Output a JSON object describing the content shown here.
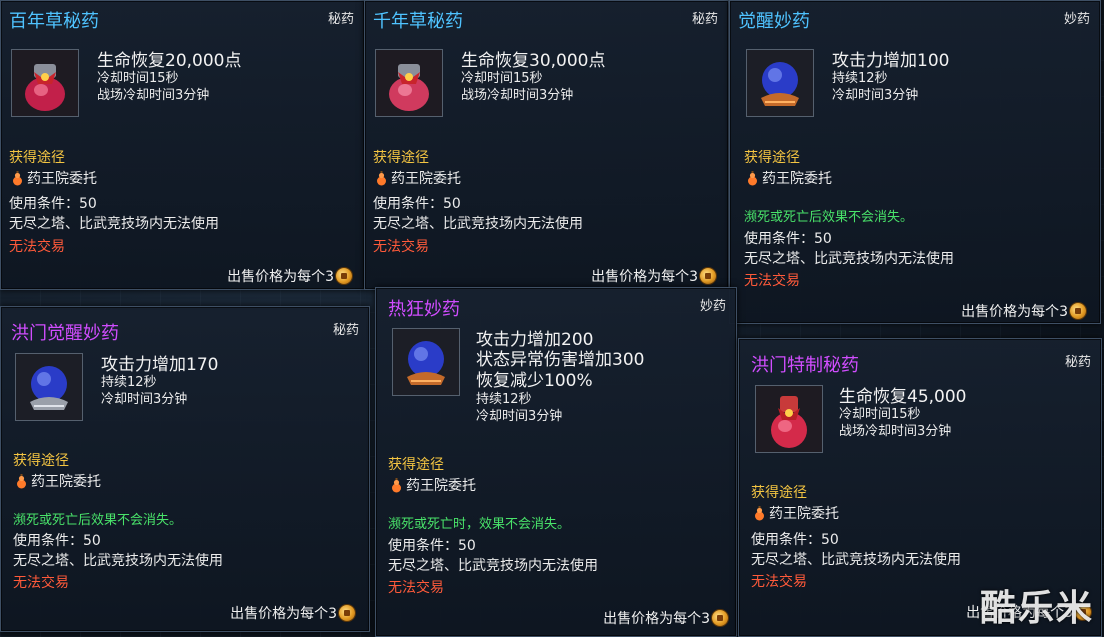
{
  "sell_label": "出售价格为每个3",
  "source_heading": "获得途径",
  "source_item": "药王院委托",
  "persist_green_a": "濒死或死亡后效果不会消失。",
  "persist_green_b": "濒死或死亡时，效果不会消失。",
  "use_condition": "使用条件：50",
  "restriction": "无尽之塔、比武竞技场内无法使用",
  "no_trade": "无法交易",
  "watermark": "酷乐米",
  "colors": {
    "title_blue": "#4fc3ff",
    "title_purple": "#d14dff",
    "source_heading": "#f4c542",
    "green_note": "#49e36a",
    "no_trade": "#ff5a3a"
  },
  "cards": [
    {
      "title": "百年草秘药",
      "category": "秘药",
      "icon": "red-potion-icon",
      "effects": [
        "生命恢复20,000点"
      ],
      "details": [
        "冷却时间15秒",
        "战场冷却时间3分钟"
      ]
    },
    {
      "title": "千年草秘药",
      "category": "秘药",
      "icon": "red-potion-icon",
      "effects": [
        "生命恢复30,000点"
      ],
      "details": [
        "冷却时间15秒",
        "战场冷却时间3分钟"
      ]
    },
    {
      "title": "觉醒妙药",
      "category": "妙药",
      "icon": "blue-orb-icon",
      "effects": [
        "攻击力增加100"
      ],
      "details": [
        "持续12秒",
        "冷却时间3分钟"
      ]
    },
    {
      "title": "洪门觉醒妙药",
      "category": "秘药",
      "icon": "blue-orb-icon",
      "effects": [
        "攻击力增加170"
      ],
      "details": [
        "持续12秒",
        "冷却时间3分钟"
      ]
    },
    {
      "title": "热狂妙药",
      "category": "妙药",
      "icon": "blue-orb-icon",
      "effects": [
        "攻击力增加200",
        "状态异常伤害增加300",
        "恢复减少100%"
      ],
      "details": [
        "持续12秒",
        "冷却时间3分钟"
      ]
    },
    {
      "title": "洪门特制秘药",
      "category": "秘药",
      "icon": "red-potion-icon",
      "effects": [
        "生命恢复45,000"
      ],
      "details": [
        "冷却时间15秒",
        "战场冷却时间3分钟"
      ]
    }
  ]
}
